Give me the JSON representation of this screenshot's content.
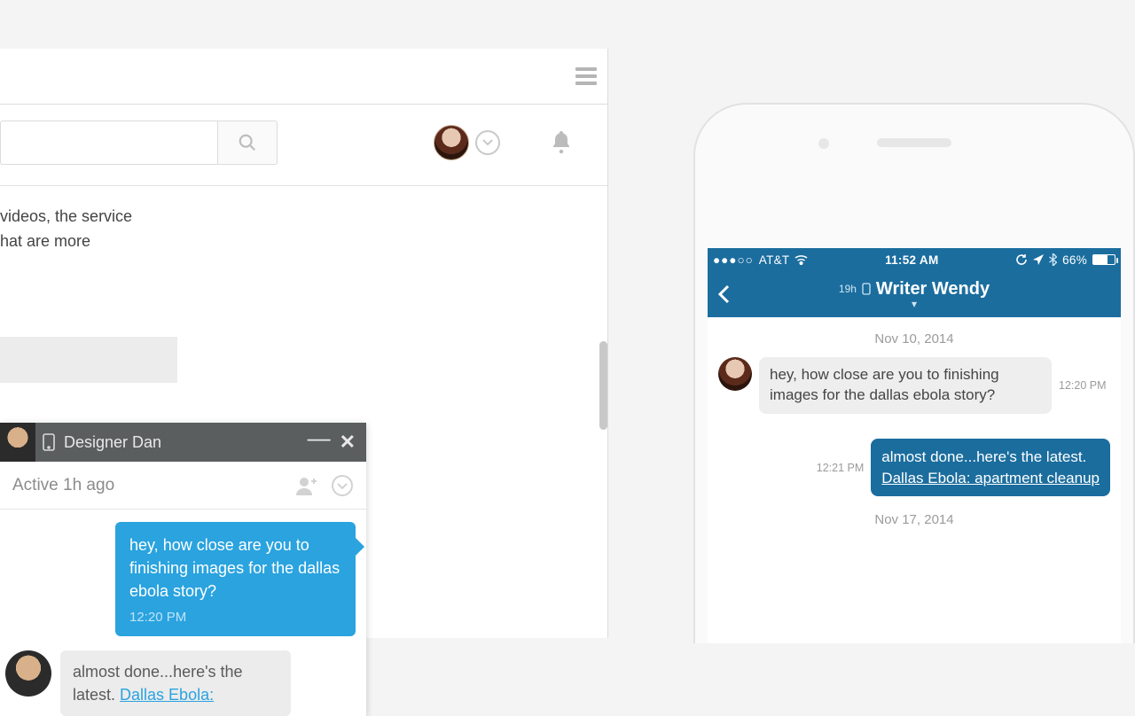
{
  "desktop": {
    "body_text_line1": " videos, the service",
    "body_text_line2": "hat are more",
    "chat": {
      "contact_name": "Designer Dan",
      "status": "Active 1h ago",
      "outgoing": {
        "text": "hey, how close are you to finishing images for the dallas ebola story?",
        "time": "12:20 PM"
      },
      "incoming": {
        "prefix": "almost done...here's the latest. ",
        "link": "Dallas Ebola:"
      }
    }
  },
  "phone": {
    "status": {
      "carrier": "AT&T",
      "time": "11:52 AM",
      "battery": "66%"
    },
    "nav": {
      "presence": "19h",
      "title": "Writer Wendy"
    },
    "conv": {
      "date1": "Nov 10, 2014",
      "msg_in": "hey, how close are you to finishing images for the dallas ebola story?",
      "msg_in_time": "12:20 PM",
      "msg_out_time": "12:21 PM",
      "msg_out_line1": "almost done...here's the latest.",
      "msg_out_link": "Dallas Ebola: apartment cleanup",
      "date2": "Nov 17, 2014"
    }
  }
}
